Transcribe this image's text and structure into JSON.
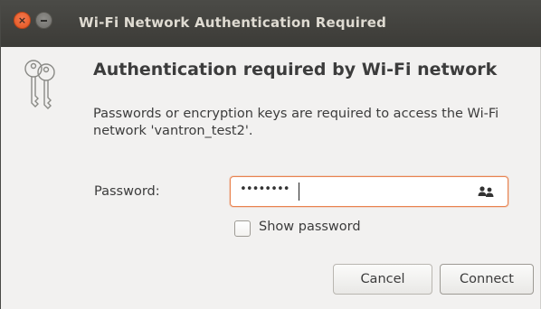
{
  "window": {
    "title": "Wi-Fi Network Authentication Required",
    "close_glyph": "×"
  },
  "dialog": {
    "icon": "keys-icon",
    "heading": "Authentication required by Wi-Fi network",
    "description": "Passwords or encryption keys are required to access the Wi-Fi network 'vantron_test2'."
  },
  "form": {
    "password_label": "Password:",
    "password_value": "••••••••",
    "user_icon": "people-icon",
    "show_password_label": "Show password",
    "show_password_checked": false
  },
  "buttons": {
    "cancel": "Cancel",
    "connect": "Connect"
  },
  "colors": {
    "titlebar": "#3c3b37",
    "close_button": "#e2531c",
    "focus_border": "#e9834f",
    "dialog_bg": "#f2f1f0"
  }
}
